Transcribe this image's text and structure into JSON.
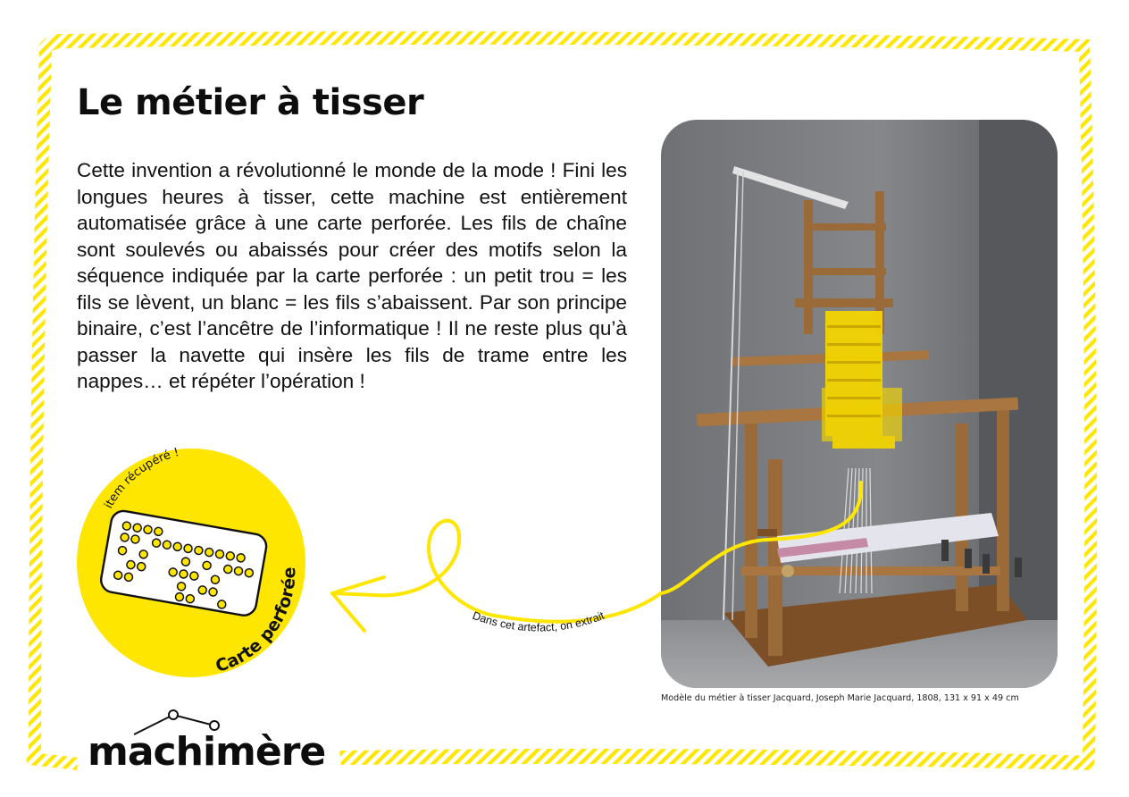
{
  "page": {
    "title": "Le métier à tisser",
    "body": "Cette invention a révolutionné le monde de la mode ! Fini les longues heures à tisser, cette machine est entière­ment automatisée grâce à une carte perforée. Les fils de chaîne sont soulevés ou abaissés pour créer des motifs selon la séquence indiquée par la carte perforée : un petit trou = les fils se lèvent, un blanc = les fils s’abaissent. Par son principe binaire, c’est l’ancêtre de l’informatique ! Il ne reste plus qu’à passer la navette qui insère les fils de trame entre les nappes… et répéter l’opération !"
  },
  "item_badge": {
    "header": "item récupéré !",
    "name": "Carte perforée"
  },
  "arrow_label": "Dans cet artefact, on extrait",
  "photo": {
    "caption": "Modèle du métier à tisser Jacquard, Joseph Marie Jacquard, 1808, 131 x 91 x 49 cm"
  },
  "brand": {
    "name": "machimère"
  },
  "colors": {
    "accent_yellow": "#ffe600",
    "text": "#111111",
    "wood": "#9a6a38",
    "background_gray": "#7c7e81"
  }
}
